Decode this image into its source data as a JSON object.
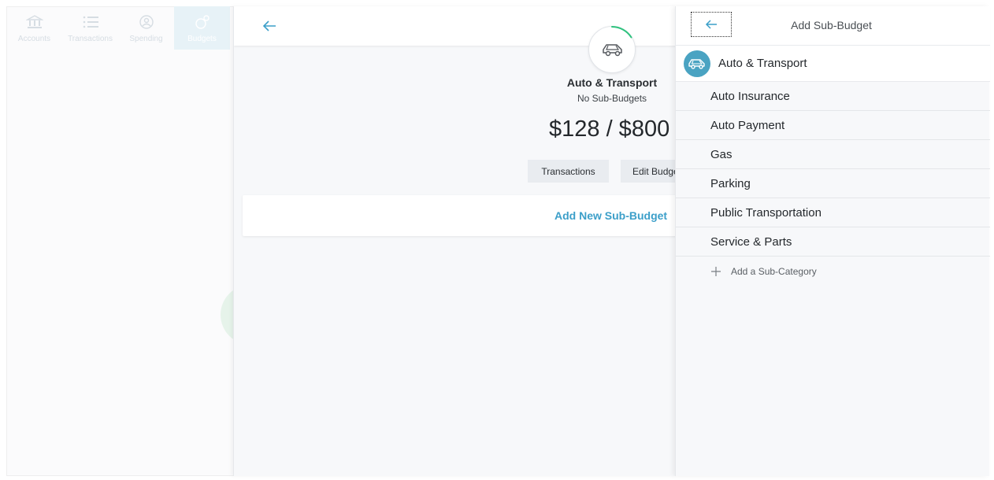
{
  "nav": {
    "items": [
      {
        "label": "Accounts",
        "icon": "bank-icon",
        "active": false
      },
      {
        "label": "Transactions",
        "icon": "list-icon",
        "active": false
      },
      {
        "label": "Spending",
        "icon": "spending-icon",
        "active": false
      },
      {
        "label": "Budgets",
        "icon": "budgets-icon",
        "active": true
      }
    ]
  },
  "budget": {
    "name": "Auto & Transport",
    "subtitle": "No Sub-Budgets",
    "amount": "$128 / $800",
    "transactions_label": "Transactions",
    "edit_label": "Edit Budget",
    "add_sub_budget_label": "Add New Sub-Budget",
    "icon": "car-icon",
    "progress_fraction": 0.16
  },
  "sub_budget_panel": {
    "title": "Add Sub-Budget",
    "category": {
      "label": "Auto & Transport",
      "icon": "car-icon"
    },
    "subcategories": [
      {
        "label": "Auto Insurance"
      },
      {
        "label": "Auto Payment"
      },
      {
        "label": "Gas"
      },
      {
        "label": "Parking"
      },
      {
        "label": "Public Transportation"
      },
      {
        "label": "Service & Parts"
      }
    ],
    "add_subcategory_label": "Add a Sub-Category"
  },
  "colors": {
    "accent": "#3c9fc9",
    "category_icon_bg": "#4aa3c2",
    "progress": "#2ec27e"
  }
}
